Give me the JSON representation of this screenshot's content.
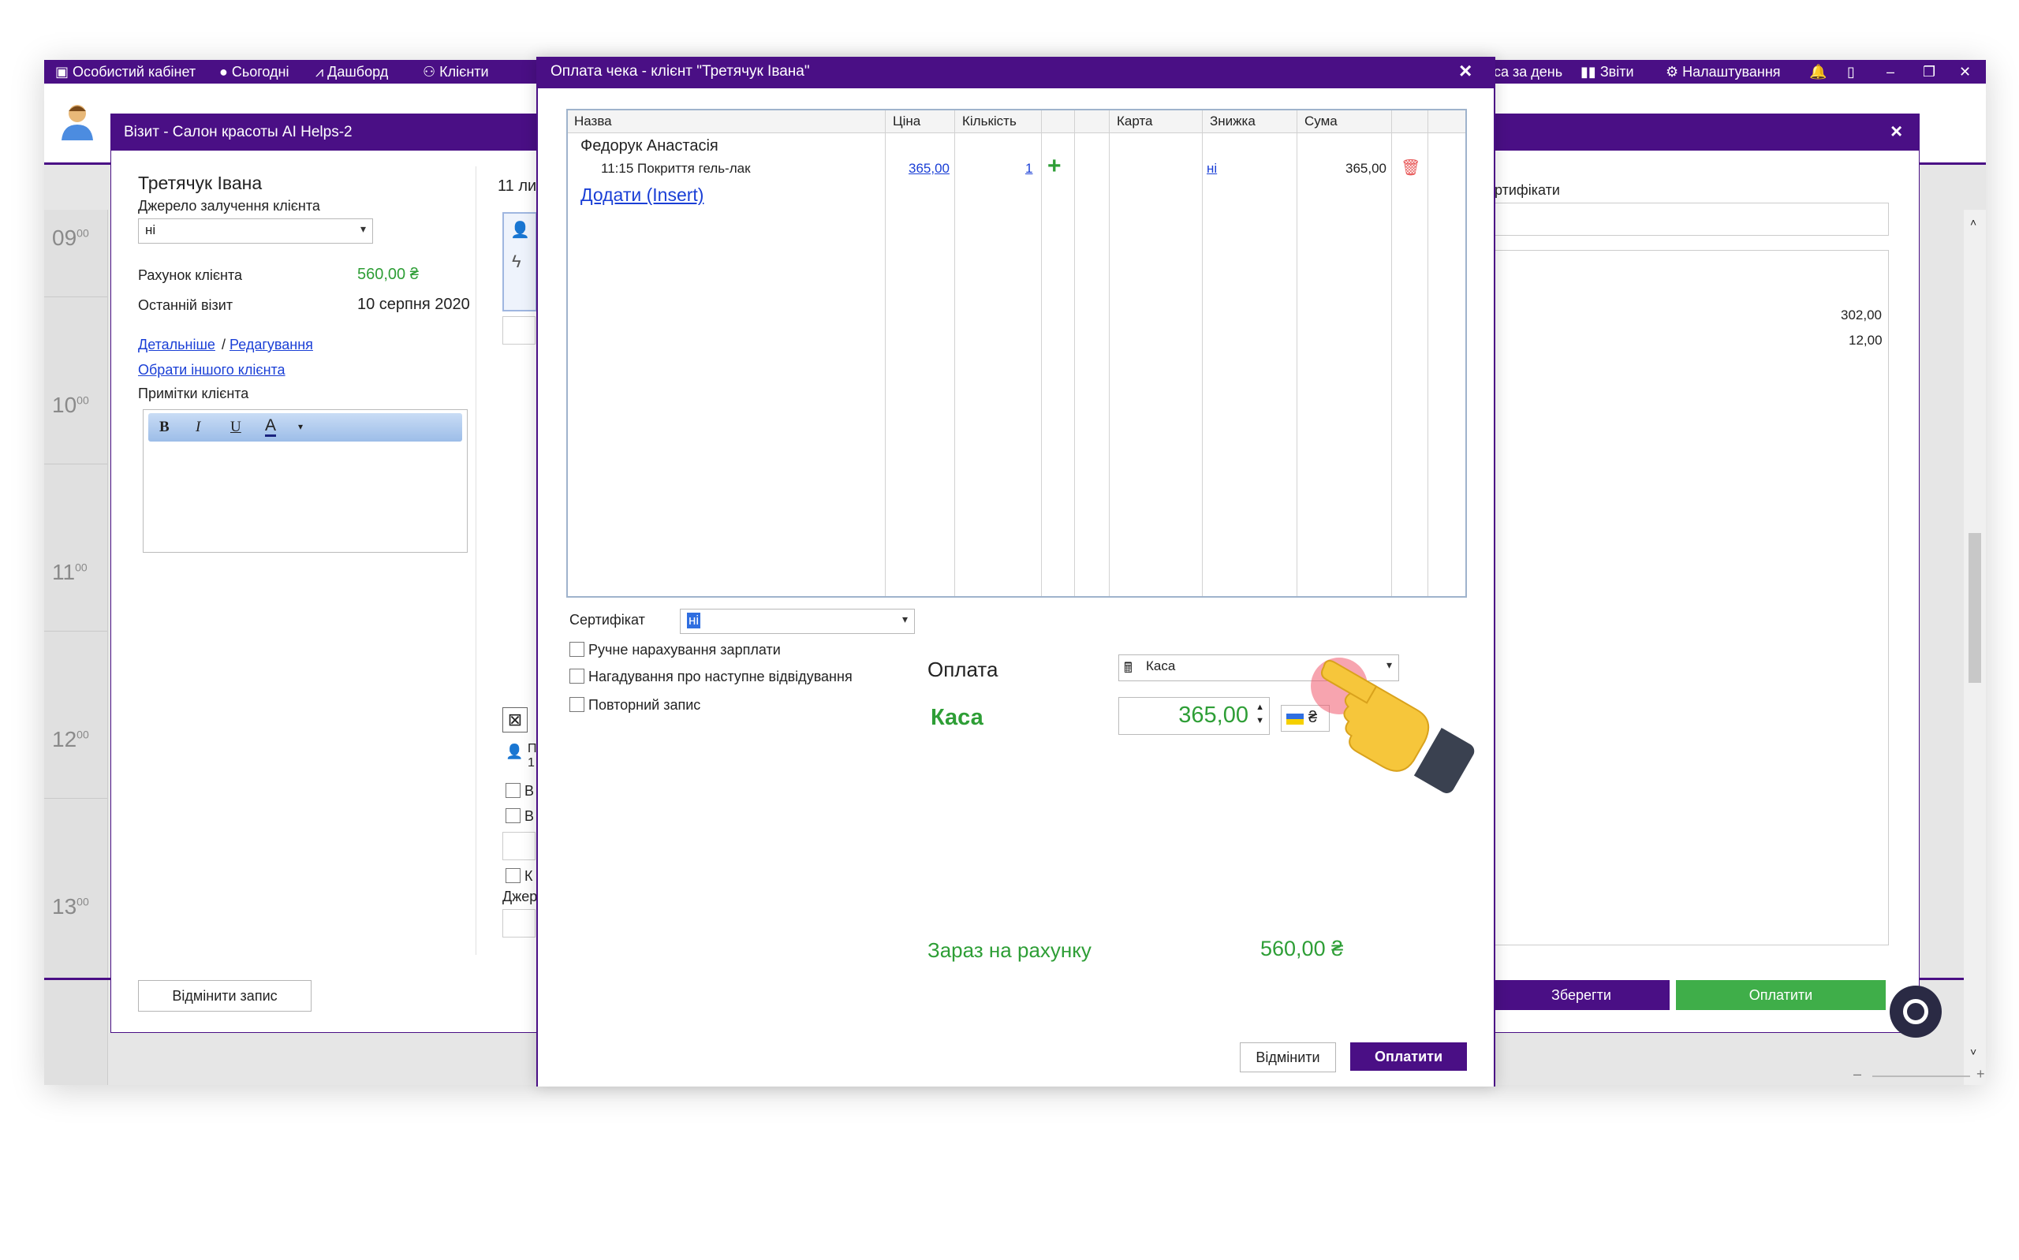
{
  "topbar": {
    "cabinet": "Особистий кабінет",
    "today": "Сьогодні",
    "dashboard": "Дашборд",
    "clients": "Клієнти",
    "cash_day": "са за день",
    "reports": "Звіти",
    "settings": "Налаштування"
  },
  "calendar": {
    "hours": [
      "09",
      "10",
      "11",
      "12",
      "13"
    ],
    "minutes": "00",
    "side_values": [
      "302,00",
      "12,00"
    ]
  },
  "visit": {
    "title": "Візит - Салон красоты AI Helps-2",
    "client_name": "Третячук Івана",
    "source_label": "Джерело залучення клієнта",
    "source_value": "ні",
    "account_label": "Рахунок клієнта",
    "account_value": "560,00 ₴",
    "last_visit_label": "Останній візит",
    "last_visit_value": "10 серпня 2020",
    "details_link": "Детальніше",
    "separator": "/",
    "edit_link": "Редагування",
    "choose_other_link": "Обрати іншого клієнта",
    "notes_label": "Примітки клієнта",
    "toolbar": {
      "bold": "B",
      "italic": "I",
      "underline": "U",
      "color": "A"
    },
    "date_partial": "11 ли",
    "partial_letters": [
      "П",
      "1",
      "В",
      "В",
      "К",
      "Джер"
    ],
    "certificates_partial": "ртифікати",
    "cancel_record": "Відмінити запис",
    "save": "Зберегти",
    "pay": "Оплатити"
  },
  "payment": {
    "title": "Оплата чека - клієнт \"Третячук Івана\"",
    "columns": [
      "Назва",
      "Ціна",
      "Кількість",
      "",
      "",
      "Карта",
      "Знижка",
      "Сума"
    ],
    "master": "Федорук Анастасія",
    "service": "11:15 Покриття гель-лак",
    "price": "365,00",
    "quantity": "1",
    "discount": "ні",
    "sum": "365,00",
    "add_link": "Додати (Insert)",
    "certificate_label": "Сертифікат",
    "certificate_value": "ні",
    "manual_salary": "Ручне нарахування зарплати",
    "next_visit_reminder": "Нагадування про наступне відвідування",
    "repeat_record": "Повторний запис",
    "payment_label": "Оплата",
    "payment_method": "Каса",
    "cash_label": "Каса",
    "cash_amount": "365,00",
    "currency": "₴",
    "balance_label": "Зараз на рахунку",
    "balance_value": "560,00 ₴",
    "cancel": "Відмінити",
    "pay": "Оплатити"
  },
  "colors": {
    "brand": "#4a0f85",
    "accent_green": "#2e9e36",
    "button_green": "#3fae49",
    "link": "#1a3fd6"
  }
}
